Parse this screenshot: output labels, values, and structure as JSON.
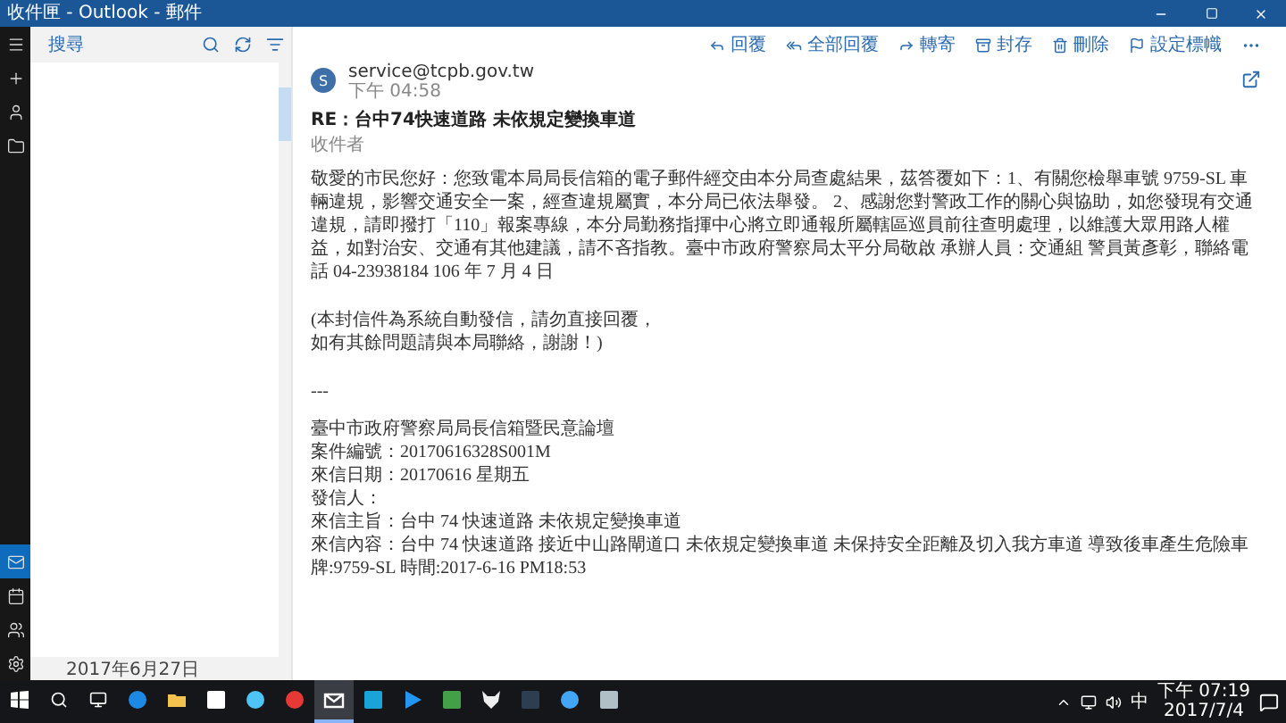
{
  "window": {
    "title": "收件匣 - Outlook - 郵件"
  },
  "rail": [
    {
      "kind": "menu",
      "selected": false
    },
    {
      "kind": "compose",
      "selected": false
    },
    {
      "kind": "account",
      "selected": false
    },
    {
      "kind": "folder",
      "selected": false
    }
  ],
  "rail_bottom": [
    {
      "kind": "mail",
      "selected": true
    },
    {
      "kind": "calendar",
      "selected": false
    },
    {
      "kind": "people",
      "selected": false
    },
    {
      "kind": "settings",
      "selected": false
    }
  ],
  "list_pane": {
    "search": {
      "placeholder": "搜尋"
    },
    "footer_date": "2017年6月27日"
  },
  "toolbar": [
    {
      "kind": "reply",
      "label": "回覆"
    },
    {
      "kind": "reply_all",
      "label": "全部回覆"
    },
    {
      "kind": "forward",
      "label": "轉寄"
    },
    {
      "kind": "archive",
      "label": "封存"
    },
    {
      "kind": "delete",
      "label": "刪除"
    },
    {
      "kind": "flag",
      "label": "設定標幟"
    }
  ],
  "message": {
    "sender_initial": "S",
    "sender": "service@tcpb.gov.tw",
    "time": "下午 04:58",
    "subject": "RE：台中74快速道路 未依規定變換車道",
    "to_label": "收件者",
    "body": "敬愛的市民您好：您致電本局局長信箱的電子郵件經交由本分局查處結果，茲答覆如下：1、有關您檢舉車號 9759-SL 車輛違規，影響交通安全一案，經查違規屬實，本分局已依法舉發。 2、感謝您對警政工作的關心與協助，如您發現有交通違規，請即撥打「110」報案專線，本分局勤務指揮中心將立即通報所屬轄區巡員前往查明處理，以維護大眾用路人權益，如對治安、交通有其他建議，請不吝指教。臺中市政府警察局太平分局敬啟 承辦人員：交通組 警員黃彥彰，聯絡電話 04-23938184 106 年 7 月 4 日",
    "notice": [
      "(本封信件為系統自動發信，請勿直接回覆，",
      "如有其餘問題請與本局聯絡，謝謝！)"
    ],
    "separator": "---",
    "details": [
      "臺中市政府警察局局長信箱暨民意論壇",
      "案件編號：20170616328S001M",
      "來信日期：20170616 星期五",
      "發信人：",
      "來信主旨：台中 74 快速道路 未依規定變換車道",
      "來信內容：台中 74 快速道路 接近中山路閘道口 未依規定變換車道 未保持安全距離及切入我方車道 導致後車產生危險車牌:9759-SL 時間:2017-6-16 PM18:53"
    ]
  },
  "taskbar": {
    "apps": [
      {
        "kind": "edge",
        "selected": false
      },
      {
        "kind": "explorer",
        "selected": false
      },
      {
        "kind": "store",
        "selected": false
      },
      {
        "kind": "ie",
        "selected": false
      },
      {
        "kind": "chrome",
        "selected": false
      },
      {
        "kind": "mail",
        "selected": true
      },
      {
        "kind": "app_blue",
        "selected": false
      },
      {
        "kind": "player",
        "selected": false
      },
      {
        "kind": "app_green",
        "selected": false
      },
      {
        "kind": "app_fox",
        "selected": false
      },
      {
        "kind": "app_dark",
        "selected": false
      },
      {
        "kind": "app_globe",
        "selected": false
      },
      {
        "kind": "app_gray",
        "selected": false
      }
    ],
    "tray": {
      "ime": "中",
      "time": "下午 07:19",
      "date": "2017/7/4"
    }
  }
}
